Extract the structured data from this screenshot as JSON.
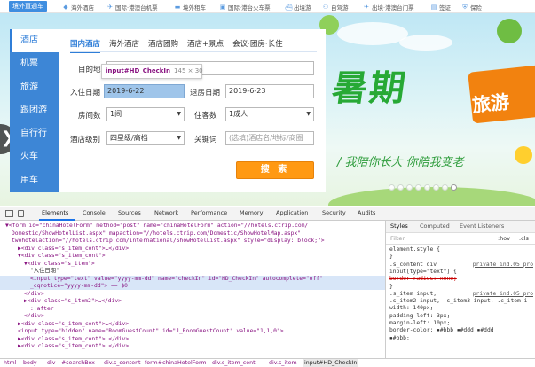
{
  "topnav": {
    "brand": "境外直通车",
    "items": [
      {
        "icon": "island-icon",
        "label": "海外酒店"
      },
      {
        "icon": "plane-icon",
        "label": "国际·港澳台机票"
      },
      {
        "icon": "car-icon",
        "label": "境外租车"
      },
      {
        "icon": "train-icon",
        "label": "国际·港台火车票"
      },
      {
        "icon": "ship-icon",
        "label": "出境游"
      },
      {
        "icon": "bike-icon",
        "label": "自驾游"
      },
      {
        "icon": "plane-icon",
        "label": "出境·港澳台门票"
      },
      {
        "icon": "passport-icon",
        "label": "签证"
      },
      {
        "icon": "shield-icon",
        "label": "保险"
      }
    ]
  },
  "search": {
    "vtabs": [
      "酒店",
      "机票",
      "旅游",
      "跟团游",
      "自行行",
      "火车",
      "用车"
    ],
    "htabs": [
      "国内酒店",
      "海外酒店",
      "酒店团购",
      "酒店+景点",
      "会议·团房·长住"
    ],
    "destination_label": "目的地",
    "checkin_label": "入住日期",
    "checkin_value": "2019-6-22",
    "checkout_label": "退房日期",
    "checkout_value": "2019-6-23",
    "rooms_label": "房间数",
    "rooms_value": "1间",
    "guests_label": "住客数",
    "guests_value": "1成人",
    "star_label": "酒店级别",
    "star_value": "四星级/高档",
    "keyword_label": "关键词",
    "keyword_placeholder": "(选填)酒店名/地标/商圈",
    "search_button": "搜 索"
  },
  "tooltip": {
    "selector": "input#HD_CheckIn",
    "size": "145 × 30"
  },
  "banner": {
    "headline": "暑期",
    "tag": "旅游",
    "slogan": "/ 我陪你长大 你陪我变老",
    "slide_count": 8,
    "active_slide": 7
  },
  "devtools": {
    "tabs": [
      "Elements",
      "Console",
      "Sources",
      "Network",
      "Performance",
      "Memory",
      "Application",
      "Security",
      "Audits"
    ],
    "active_tab": "Elements",
    "code_lines": [
      {
        "indent": 0,
        "html": "▼<form id=\"chinaHotelForm\" method=\"post\" name=\"chinaHotelForm\" action=\"//hotels.ctrip.com/",
        "hl": false
      },
      {
        "indent": 1,
        "html": "Domestic/ShowHotelList.aspx\" mapaction=\"//hotels.ctrip.com/Domestic/ShowHotelMap.aspx\"",
        "hl": false
      },
      {
        "indent": 1,
        "html": "twohotelaction=\"//hotels.ctrip.com/international/ShowHotelList.aspx\" style=\"display: block;\">",
        "hl": false
      },
      {
        "indent": 2,
        "html": "▶<div class=\"s_item_cont\">…</div>",
        "hl": false
      },
      {
        "indent": 2,
        "html": "▼<div class=\"s_item_cont\">",
        "hl": false
      },
      {
        "indent": 3,
        "html": "▼<div class=\"s_item\">",
        "hl": false
      },
      {
        "indent": 4,
        "html": "\"入住日期\"",
        "hl": false
      },
      {
        "indent": 4,
        "html": "<input type=\"text\" value=\"yyyy-mm-dd\" name=\"checkIn\" id=\"HD_CheckIn\" autocomplete=\"off\"",
        "hl": true
      },
      {
        "indent": 4,
        "html": "_cqnotice=\"yyyy-mm-dd\"> == $0",
        "hl": true
      },
      {
        "indent": 3,
        "html": "</div>",
        "hl": false
      },
      {
        "indent": 3,
        "html": "▶<div class=\"s_item2\">…</div>",
        "hl": false
      },
      {
        "indent": 4,
        "html": "::after",
        "hl": false
      },
      {
        "indent": 3,
        "html": "</div>",
        "hl": false
      },
      {
        "indent": 2,
        "html": "▶<div class=\"s_item_cont\">…</div>",
        "hl": false
      },
      {
        "indent": 2,
        "html": "<input type=\"hidden\" name=\"RoomGuestCount\" id=\"J_RoomGuestCount\" value=\"1,1,0\">",
        "hl": false
      },
      {
        "indent": 2,
        "html": "▶<div class=\"s_item_cont\">…</div>",
        "hl": false
      },
      {
        "indent": 2,
        "html": "▶<div class=\"s_item_cont\">…</div>",
        "hl": false
      }
    ],
    "styles_tabs": [
      "Styles",
      "Computed",
      "Event Listeners"
    ],
    "filter_placeholder": "Filter",
    "filter_hov": ":hov",
    "filter_cls": ".cls",
    "rules": [
      {
        "text": "element.style {"
      },
      {
        "text": "}"
      },
      {
        "text": ".s_content div",
        "link": "private_ind.05_pro"
      },
      {
        "text": "input[type=\"text\"] {"
      },
      {
        "text": "  border-radius: none;",
        "strike": true
      },
      {
        "text": "}"
      },
      {
        "text": ".s_item input,",
        "link": "private_ind.05_pro"
      },
      {
        "text": ".s_item2 input, .s_item3 input, .c_item i"
      },
      {
        "text": "  width: 140px;"
      },
      {
        "text": "  padding-left: 3px;"
      },
      {
        "text": "  margin-left: 10px;"
      },
      {
        "text": "  border-color: ▪#bbb ▪#ddd ▪#ddd"
      },
      {
        "text": "  ▪#bbb;"
      }
    ],
    "breadcrumb": [
      "html",
      "body",
      "div",
      "#searchBox",
      "div.s_content",
      "form#chinaHotelForm",
      "div.s_item_cont",
      "div.s_item",
      "input#HD_CheckIn"
    ]
  },
  "colors": {
    "accent_blue": "#2f7ed8",
    "search_orange": "#ff9913",
    "promo_green": "#27a935"
  }
}
